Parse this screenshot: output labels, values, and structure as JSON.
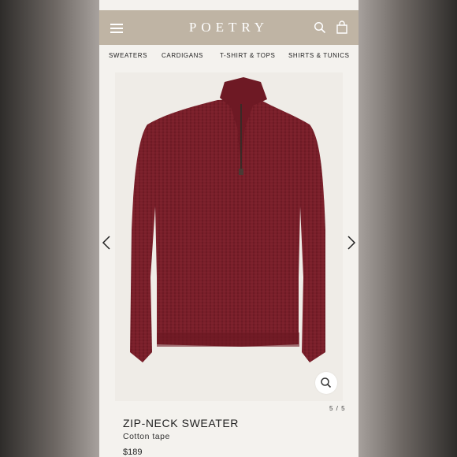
{
  "header": {
    "brand": "POETRY"
  },
  "nav": {
    "items": [
      "SWEATERS",
      "CARDIGANS",
      "T-SHIRT & TOPS",
      "SHIRTS & TUNICS"
    ]
  },
  "gallery": {
    "counter": "5 / 5"
  },
  "product": {
    "name": "ZIP-NECK SWEATER",
    "material": "Cotton tape",
    "price": "$189"
  },
  "icons": {
    "menu": "menu-icon",
    "search": "search-icon",
    "bag": "bag-icon",
    "prev": "chevron-left-icon",
    "next": "chevron-right-icon",
    "zoom": "zoom-icon"
  },
  "colors": {
    "header": "#bfb4a4",
    "background": "#f4f2ee",
    "sweater": "#7a1f2a"
  }
}
